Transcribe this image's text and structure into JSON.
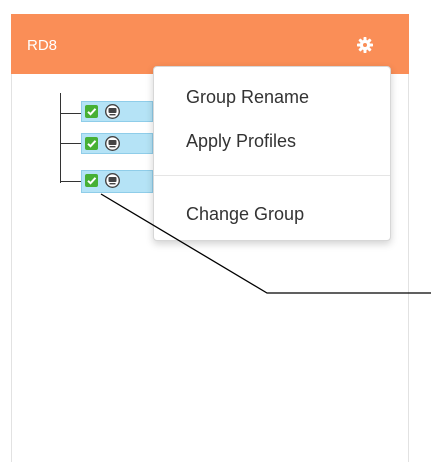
{
  "panel": {
    "title": "RD8",
    "header_color": "#fa8e57"
  },
  "icons": {
    "settings": "gear-icon",
    "check": "green-checkmark-icon",
    "device": "device-icon"
  },
  "tree": {
    "rows": [
      {
        "checked": true
      },
      {
        "checked": true
      },
      {
        "checked": true
      }
    ],
    "row_highlight_color": "#b5e3f6"
  },
  "context_menu": {
    "items": [
      {
        "label": "Group Rename"
      },
      {
        "label": "Apply Profiles"
      },
      {
        "label": "Change Group"
      }
    ]
  }
}
